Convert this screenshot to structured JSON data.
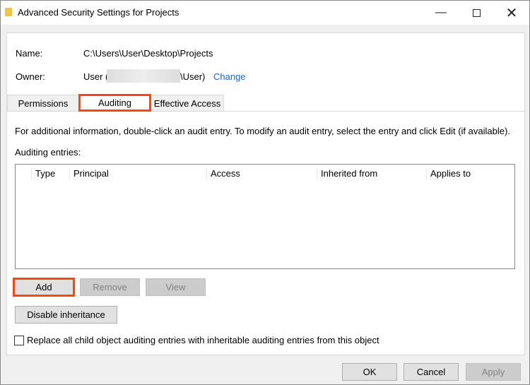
{
  "window": {
    "title": "Advanced Security Settings for Projects",
    "icon": "folder-icon",
    "controls": [
      "minimize",
      "maximize",
      "close"
    ]
  },
  "info": {
    "name_label": "Name:",
    "name_value": "C:\\Users\\User\\Desktop\\Projects",
    "owner_label": "Owner:",
    "owner_prefix": "User (",
    "owner_suffix": "\\User)",
    "change_link": "Change"
  },
  "tabs": [
    {
      "label": "Permissions"
    },
    {
      "label": "Auditing",
      "active": true
    },
    {
      "label": "Effective Access"
    }
  ],
  "auditing": {
    "info_text": "For additional information, double-click an audit entry. To modify an audit entry, select the entry and click Edit (if available).",
    "entries_label": "Auditing entries:",
    "columns": [
      "Type",
      "Principal",
      "Access",
      "Inherited from",
      "Applies to"
    ],
    "rows": []
  },
  "buttons": {
    "add": "Add",
    "remove": "Remove",
    "view": "View",
    "disable_inheritance": "Disable inheritance",
    "ok": "OK",
    "cancel": "Cancel",
    "apply": "Apply"
  },
  "checkbox": {
    "label": "Replace all child object auditing entries with inheritable auditing entries from this object",
    "checked": false
  },
  "highlight_color": "#f04a13"
}
